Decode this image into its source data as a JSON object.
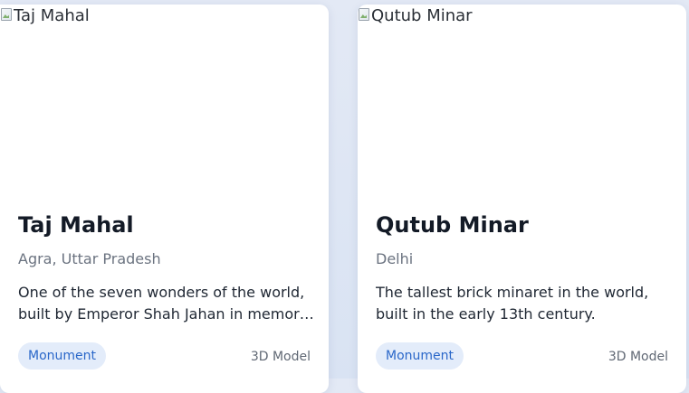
{
  "cards": [
    {
      "image_alt": "Taj Mahal",
      "title": "Taj Mahal",
      "location": "Agra, Uttar Pradesh",
      "description_lines": [
        "One of the seven wonders of the world,",
        "built by Emperor Shah Jahan in memory..."
      ],
      "tag": "Monument",
      "model_label": "3D Model"
    },
    {
      "image_alt": "Qutub Minar",
      "title": "Qutub Minar",
      "location": "Delhi",
      "description_lines": [
        "The tallest brick minaret in the world,",
        "built in the early 13th century."
      ],
      "tag": "Monument",
      "model_label": "3D Model"
    }
  ],
  "icons": {
    "broken_image": "broken-image-icon"
  },
  "colors": {
    "tag_background": "#e3ecfa",
    "tag_text": "#2a67c9",
    "title": "#131a26",
    "location": "#6b7380"
  }
}
